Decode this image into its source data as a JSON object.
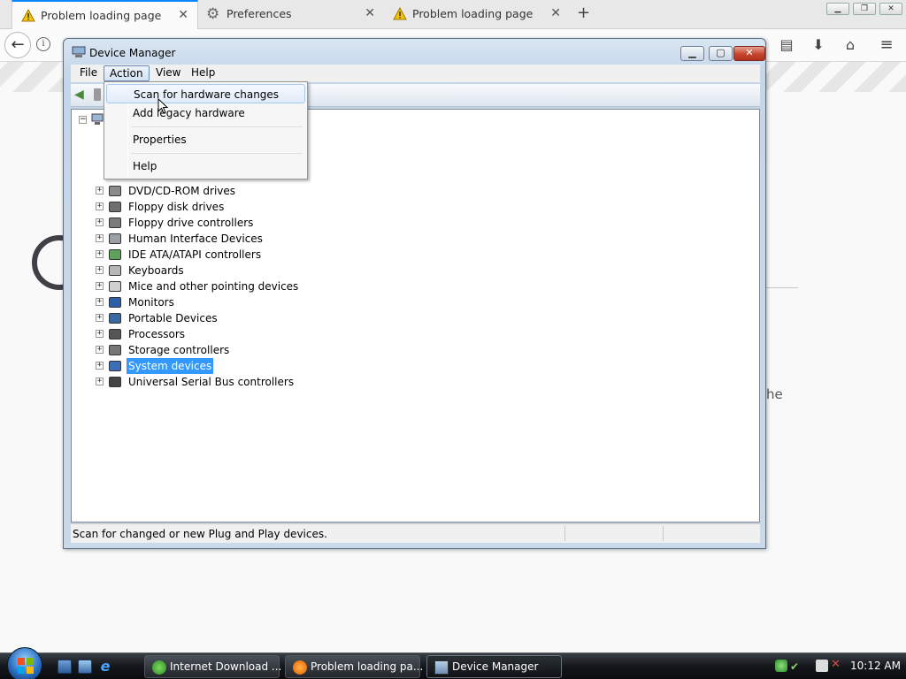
{
  "browser": {
    "tabs": [
      {
        "title": "Problem loading page",
        "icon": "warning-icon",
        "active": true
      },
      {
        "title": "Preferences",
        "icon": "gear-icon",
        "active": false
      },
      {
        "title": "Problem loading page",
        "icon": "warning-icon",
        "active": false
      }
    ],
    "new_tab": "+",
    "info_glyph": "i",
    "page_fragment": "he"
  },
  "device_manager": {
    "title": "Device Manager",
    "menus": [
      "File",
      "Action",
      "View",
      "Help"
    ],
    "open_menu": "Action",
    "action_menu": [
      {
        "label": "Scan for hardware changes",
        "hovered": true
      },
      {
        "label": "Add legacy hardware",
        "hovered": false
      },
      {
        "label": "Properties",
        "hovered": false
      },
      {
        "label": "Help",
        "hovered": false
      }
    ],
    "devices": [
      {
        "label": "DVD/CD-ROM drives",
        "icon": "dvd-drive-icon"
      },
      {
        "label": "Floppy disk drives",
        "icon": "floppy-disk-icon"
      },
      {
        "label": "Floppy drive controllers",
        "icon": "floppy-controller-icon"
      },
      {
        "label": "Human Interface Devices",
        "icon": "hid-icon"
      },
      {
        "label": "IDE ATA/ATAPI controllers",
        "icon": "ide-controller-icon"
      },
      {
        "label": "Keyboards",
        "icon": "keyboard-icon"
      },
      {
        "label": "Mice and other pointing devices",
        "icon": "mouse-icon"
      },
      {
        "label": "Monitors",
        "icon": "monitor-icon"
      },
      {
        "label": "Portable Devices",
        "icon": "portable-device-icon"
      },
      {
        "label": "Processors",
        "icon": "processor-icon"
      },
      {
        "label": "Storage controllers",
        "icon": "storage-controller-icon"
      },
      {
        "label": "System devices",
        "icon": "system-devices-icon",
        "selected": true
      },
      {
        "label": "Universal Serial Bus controllers",
        "icon": "usb-icon"
      }
    ],
    "status_text": "Scan for changed or new Plug and Play devices."
  },
  "taskbar": {
    "buttons": [
      {
        "label": "Internet Download ...",
        "icon": "idm-icon",
        "active": false
      },
      {
        "label": "Problem loading pa...",
        "icon": "firefox-icon",
        "active": false
      },
      {
        "label": "Device Manager",
        "icon": "device-manager-icon",
        "active": true
      }
    ],
    "clock": "10:12 AM"
  },
  "colors": {
    "selection": "#3399ff",
    "tab_accent": "#0a84ff",
    "close_button": "#c6452e"
  }
}
